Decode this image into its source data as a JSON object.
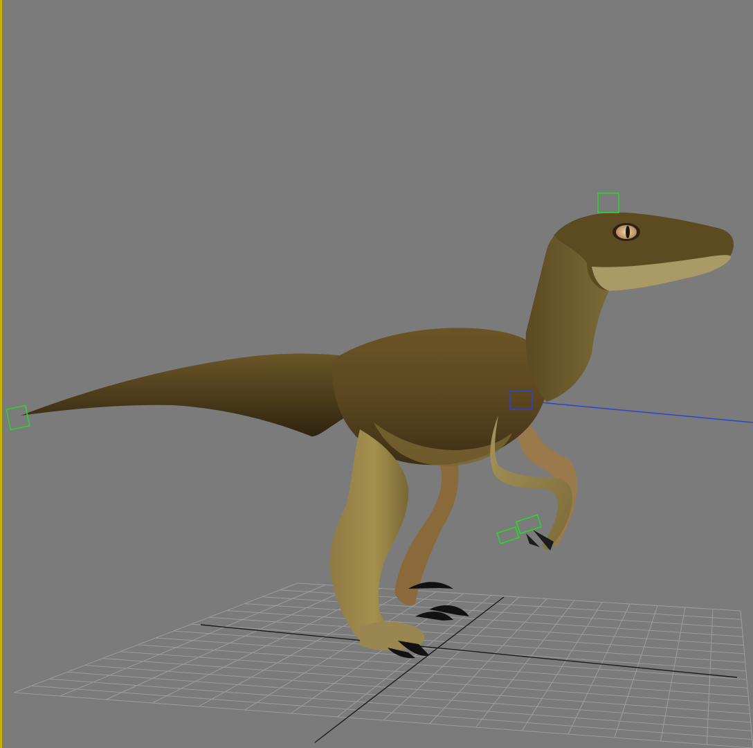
{
  "viewport": {
    "view": "perspective",
    "background_color": "#7b7b7b",
    "active_border_color": "#c8b400",
    "grid_color": "#9c9c9c",
    "grid_axis_color": "#1a1a1a"
  },
  "model": {
    "subject": "velociraptor",
    "skin_color": "#5b4a22",
    "belly_color": "#9c8a52",
    "claw_color": "#1b1b1b",
    "eye_color": "#d8b48a"
  },
  "rig": {
    "control_color": "#2bd62b",
    "selected_control_color": "#2a46c8",
    "controls": [
      "head-control",
      "tail-control",
      "hand-control",
      "foot-control",
      "shoulder-control"
    ]
  }
}
